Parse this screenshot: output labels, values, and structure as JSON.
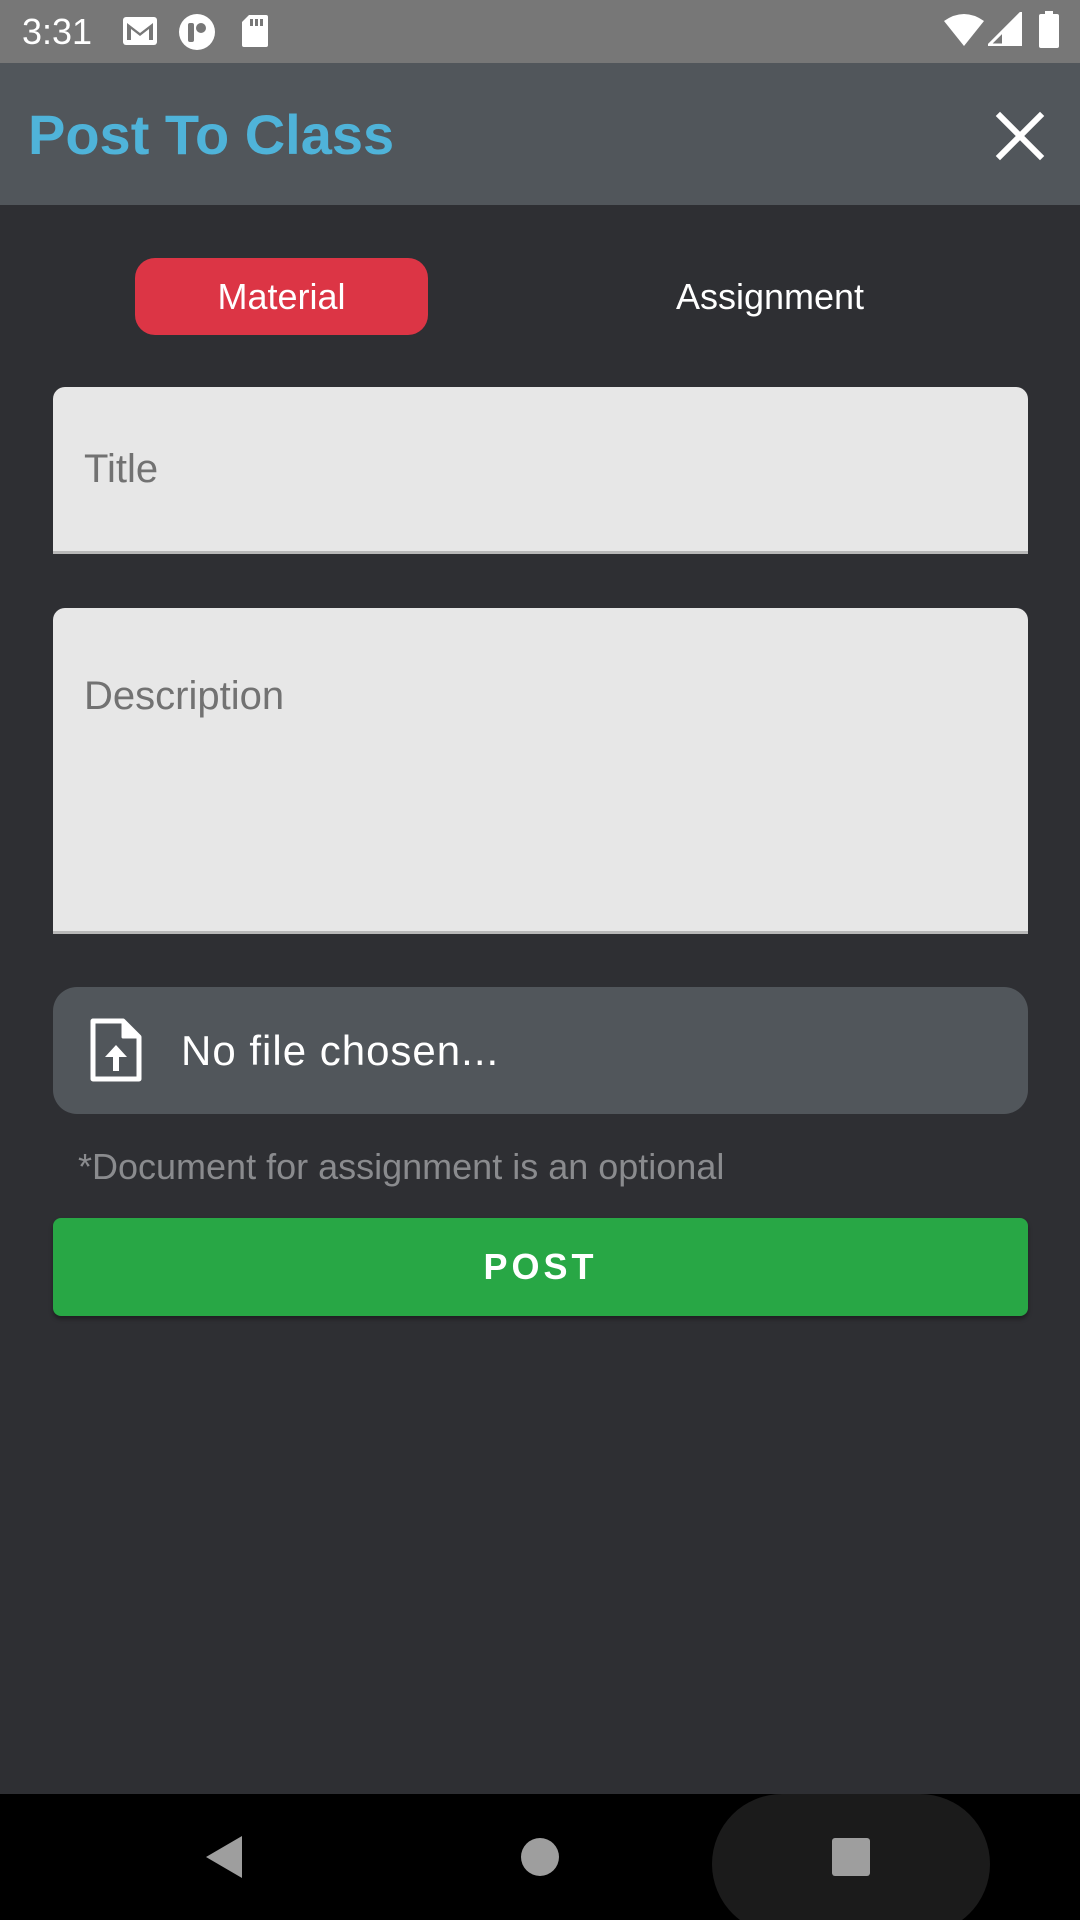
{
  "status_bar": {
    "time": "3:31"
  },
  "app_bar": {
    "title": "Post To Class"
  },
  "tabs": [
    {
      "label": "Material",
      "selected": true
    },
    {
      "label": "Assignment",
      "selected": false
    }
  ],
  "form": {
    "title_placeholder": "Title",
    "description_placeholder": "Description",
    "file_label": "No file chosen...",
    "hint": "*Document for assignment is an optional",
    "post_label": "POST"
  },
  "colors": {
    "title": "#4fb3d9",
    "selected_tab": "#dc3545",
    "post_button": "#28a745",
    "background": "#2e2f33",
    "app_bar": "#51565b"
  },
  "icons": {
    "status": [
      "gmail-icon",
      "app-notification-icon",
      "sd-card-icon",
      "wifi-icon",
      "signal-icon",
      "battery-icon"
    ],
    "close": "close-icon",
    "file": "file-upload-icon",
    "nav": [
      "back-icon",
      "home-icon",
      "recents-icon"
    ]
  }
}
